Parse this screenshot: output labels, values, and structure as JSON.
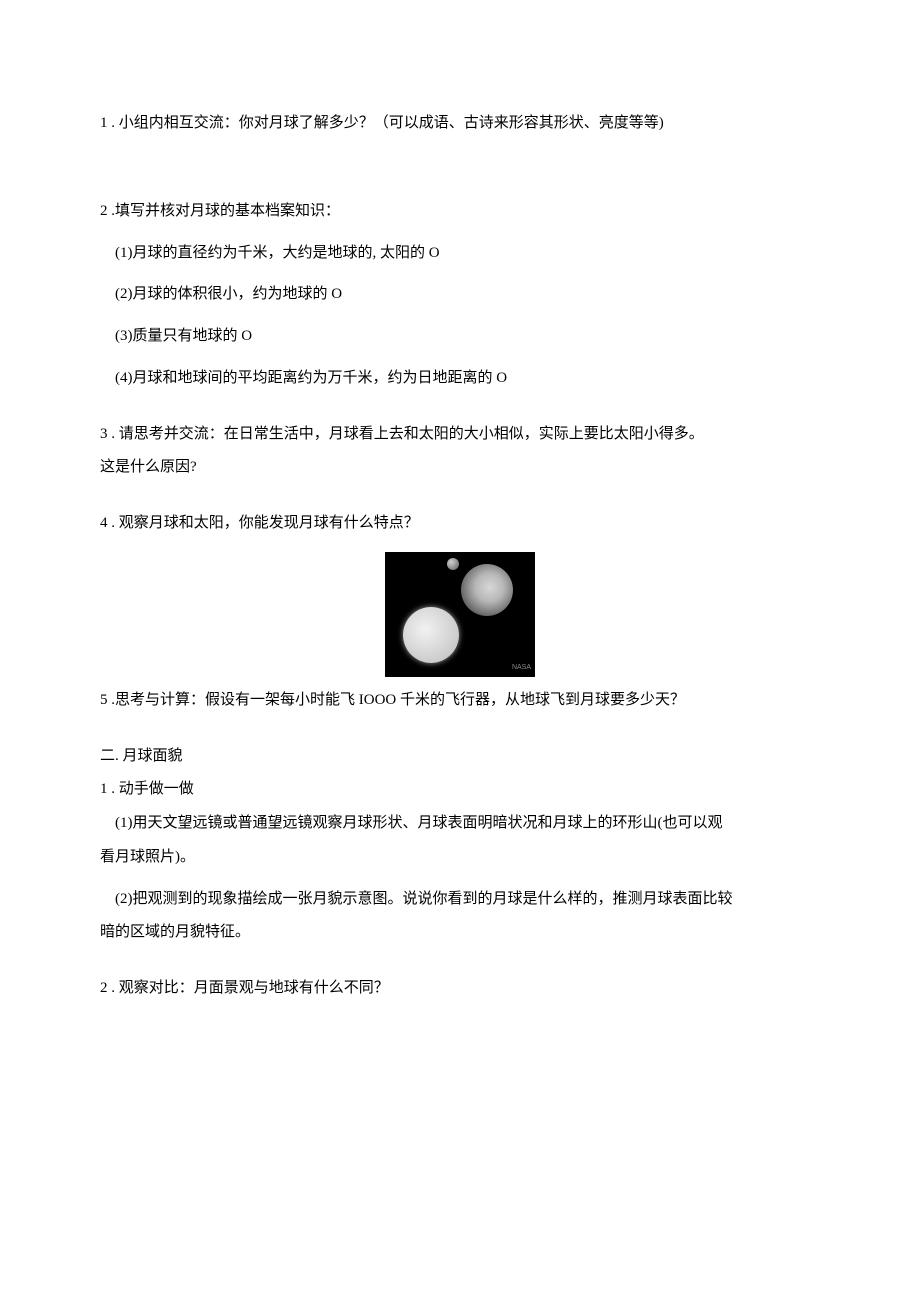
{
  "q1": {
    "text": "1 . 小组内相互交流：你对月球了解多少？（可以成语、古诗来形容其形状、亮度等等)"
  },
  "q2": {
    "lead": "2  .填写并核对月球的基本档案知识：",
    "items": [
      "(1)月球的直径约为千米，大约是地球的, 太阳的 O",
      "(2)月球的体积很小，约为地球的 O",
      "(3)质量只有地球的 O",
      "(4)月球和地球间的平均距离约为万千米，约为日地距离的 O"
    ]
  },
  "q3": {
    "line1": "3  . 请思考并交流：在日常生活中，月球看上去和太阳的大小相似，实际上要比太阳小得多。",
    "line2": "这是什么原因?"
  },
  "q4": {
    "text": "4  . 观察月球和太阳，你能发现月球有什么特点？"
  },
  "q5": {
    "text": "5  .思考与计算：假设有一架每小时能飞 IOOO 千米的飞行器，从地球飞到月球要多少天？"
  },
  "section2": {
    "title": "二. 月球面貌",
    "q1": {
      "lead": "1 . 动手做一做",
      "p1a": "(1)用天文望远镜或普通望远镜观察月球形状、月球表面明暗状况和月球上的环形山(也可以观",
      "p1b": "看月球照片)。",
      "p2a": "(2)把观测到的现象描绘成一张月貌示意图。说说你看到的月球是什么样的，推测月球表面比较",
      "p2b": "暗的区域的月貌特征。"
    },
    "q2": {
      "text": "2  . 观察对比：月面景观与地球有什么不同？"
    }
  },
  "image": {
    "caption": "NASA"
  }
}
